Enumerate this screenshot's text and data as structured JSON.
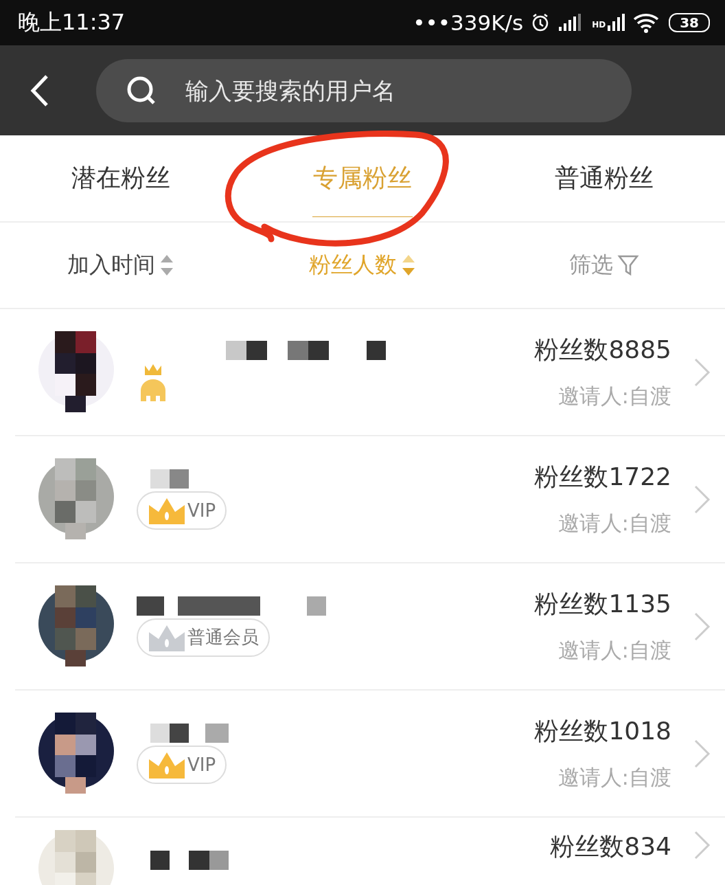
{
  "status_bar": {
    "time": "晚上11:37",
    "speed": "•••339K/s",
    "network": "HD",
    "battery": "38"
  },
  "search": {
    "placeholder": "输入要搜索的用户名"
  },
  "tabs": [
    {
      "label": "潜在粉丝",
      "selected": false
    },
    {
      "label": "专属粉丝",
      "selected": true
    },
    {
      "label": "普通粉丝",
      "selected": false
    }
  ],
  "sort_bar": [
    {
      "label": "加入时间",
      "kind": "sort",
      "selected": false
    },
    {
      "label": "粉丝人数",
      "kind": "sort",
      "selected": true
    },
    {
      "label": "筛选",
      "kind": "filter",
      "selected": false
    }
  ],
  "fans": [
    {
      "badge": {
        "kind": "elephant"
      },
      "fan_count": "粉丝数8885",
      "inviter": "邀请人:自渡"
    },
    {
      "badge": {
        "kind": "vip",
        "label": "VIP"
      },
      "fan_count": "粉丝数1722",
      "inviter": "邀请人:自渡"
    },
    {
      "badge": {
        "kind": "regular",
        "label": "普通会员"
      },
      "fan_count": "粉丝数1135",
      "inviter": "邀请人:自渡"
    },
    {
      "badge": {
        "kind": "vip",
        "label": "VIP"
      },
      "fan_count": "粉丝数1018",
      "inviter": "邀请人:自渡"
    },
    {
      "fan_count": "粉丝数834"
    }
  ]
}
